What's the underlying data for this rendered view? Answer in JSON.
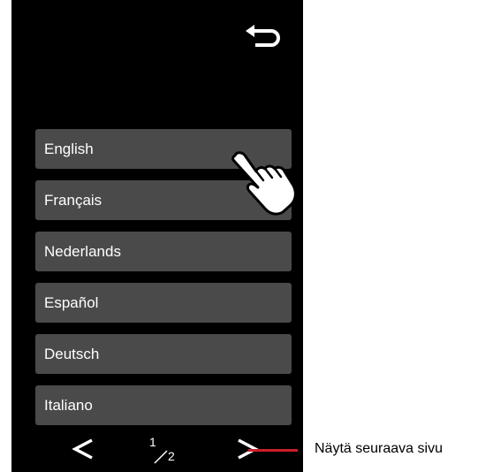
{
  "languages": [
    {
      "label": "English"
    },
    {
      "label": "Français"
    },
    {
      "label": "Nederlands"
    },
    {
      "label": "Español"
    },
    {
      "label": "Deutsch"
    },
    {
      "label": "Italiano"
    }
  ],
  "pager": {
    "current": "1",
    "total": "2"
  },
  "callout": {
    "text": "Näytä seuraava sivu"
  },
  "colors": {
    "screen": "#000000",
    "button": "#4a4a4a",
    "text": "#ffffff",
    "callout_line": "#cc1f2a"
  },
  "icons": {
    "back": "back-arrow-icon",
    "prev": "chevron-left-icon",
    "next": "chevron-right-icon",
    "hand": "pointing-hand-icon"
  }
}
